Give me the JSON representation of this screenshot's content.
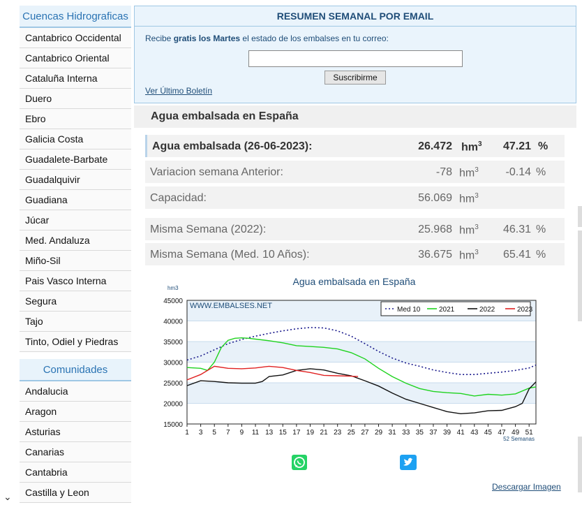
{
  "sidebar": {
    "cuencas_title": "Cuencas Hidrograficas",
    "cuencas": [
      "Cantabrico Occidental",
      "Cantabrico Oriental",
      "Cataluña Interna",
      "Duero",
      "Ebro",
      "Galicia Costa",
      "Guadalete-Barbate",
      "Guadalquivir",
      "Guadiana",
      "Júcar",
      "Med. Andaluza",
      "Miño-Sil",
      "Pais Vasco Interna",
      "Segura",
      "Tajo",
      "Tinto, Odiel y Piedras"
    ],
    "comunidades_title": "Comunidades",
    "comunidades": [
      "Andalucia",
      "Aragon",
      "Asturias",
      "Canarias",
      "Cantabria",
      "Castilla y Leon"
    ]
  },
  "email": {
    "title": "RESUMEN SEMANAL POR EMAIL",
    "text_pre": "Recibe ",
    "text_bold": "gratis los Martes",
    "text_post": " el estado de los embalses en tu correo:",
    "input_value": "",
    "button": "Suscribirme",
    "link": "Ver Último Boletín"
  },
  "section_title": "Agua embalsada en España",
  "stats": [
    {
      "label": "Agua embalsada (26-06-2023):",
      "value": "26.472",
      "unit": "hm",
      "pct": "47.21",
      "pct_sign": "%"
    },
    {
      "label": "Variacion semana Anterior:",
      "value": "-78",
      "unit": "hm",
      "pct": "-0.14",
      "pct_sign": "%"
    },
    {
      "label": "Capacidad:",
      "value": "56.069",
      "unit": "hm",
      "pct": "",
      "pct_sign": ""
    },
    {
      "label": "Misma Semana (2022):",
      "value": "25.968",
      "unit": "hm",
      "pct": "46.31",
      "pct_sign": "%"
    },
    {
      "label": "Misma Semana (Med. 10 Años):",
      "value": "36.675",
      "unit": "hm",
      "pct": "65.41",
      "pct_sign": "%"
    }
  ],
  "unit_sup": "3",
  "download_label": "Descargar Imagen",
  "chart_data": {
    "type": "line",
    "title": "Agua embalsada en España",
    "ylabel": "hm3",
    "watermark": "WWW.EMBALSES.NET",
    "x_note": "52 Semanas",
    "ylim": [
      15000,
      45000
    ],
    "yticks": [
      15000,
      20000,
      25000,
      30000,
      35000,
      40000,
      45000
    ],
    "xticks": [
      1,
      3,
      5,
      7,
      9,
      11,
      13,
      15,
      17,
      19,
      21,
      23,
      25,
      27,
      29,
      31,
      33,
      35,
      37,
      39,
      41,
      43,
      45,
      47,
      49,
      51
    ],
    "colors": {
      "Med 10": "#1a1a8c",
      "2021": "#1fd31f",
      "2022": "#111111",
      "2023": "#e02020"
    },
    "series": [
      {
        "name": "Med 10",
        "style": "dotted",
        "x": [
          1,
          3,
          5,
          7,
          9,
          11,
          13,
          15,
          17,
          19,
          21,
          23,
          25,
          27,
          29,
          31,
          33,
          35,
          37,
          39,
          41,
          43,
          45,
          47,
          49,
          51,
          52
        ],
        "y": [
          30500,
          31500,
          33000,
          34500,
          35500,
          36300,
          37000,
          37600,
          38100,
          38400,
          38300,
          37600,
          36300,
          34500,
          32600,
          31000,
          29800,
          29000,
          28100,
          27500,
          27000,
          27000,
          27300,
          27600,
          28000,
          28600,
          29300
        ]
      },
      {
        "name": "2021",
        "style": "solid",
        "x": [
          1,
          3,
          4,
          5,
          6,
          7,
          8,
          9,
          10,
          11,
          13,
          15,
          17,
          19,
          21,
          23,
          25,
          27,
          29,
          31,
          33,
          35,
          37,
          39,
          41,
          43,
          45,
          47,
          49,
          51,
          52
        ],
        "y": [
          28700,
          28500,
          28000,
          30000,
          33500,
          35300,
          35800,
          35900,
          35800,
          35600,
          35200,
          34700,
          34000,
          33800,
          33600,
          33200,
          32300,
          30800,
          28500,
          26500,
          24900,
          23600,
          22900,
          22600,
          22400,
          21800,
          22200,
          22000,
          22300,
          23700,
          24000
        ]
      },
      {
        "name": "2022",
        "style": "solid",
        "x": [
          1,
          3,
          5,
          7,
          9,
          11,
          12,
          13,
          15,
          17,
          19,
          21,
          23,
          25,
          27,
          29,
          31,
          33,
          35,
          37,
          39,
          41,
          43,
          45,
          47,
          49,
          50,
          51,
          52
        ],
        "y": [
          24300,
          25500,
          25300,
          25000,
          24900,
          24900,
          25300,
          26500,
          26900,
          28000,
          28400,
          28100,
          27300,
          26700,
          25500,
          24200,
          22500,
          21000,
          20000,
          19000,
          18000,
          17500,
          17700,
          18200,
          18300,
          19200,
          20000,
          23500,
          25200
        ]
      },
      {
        "name": "2023",
        "style": "solid",
        "x": [
          1,
          3,
          5,
          7,
          9,
          11,
          13,
          15,
          17,
          19,
          21,
          23,
          25,
          26
        ],
        "y": [
          25700,
          27000,
          29000,
          28500,
          28400,
          28600,
          29000,
          28700,
          28000,
          27500,
          26800,
          26700,
          26600,
          26500
        ]
      }
    ]
  }
}
